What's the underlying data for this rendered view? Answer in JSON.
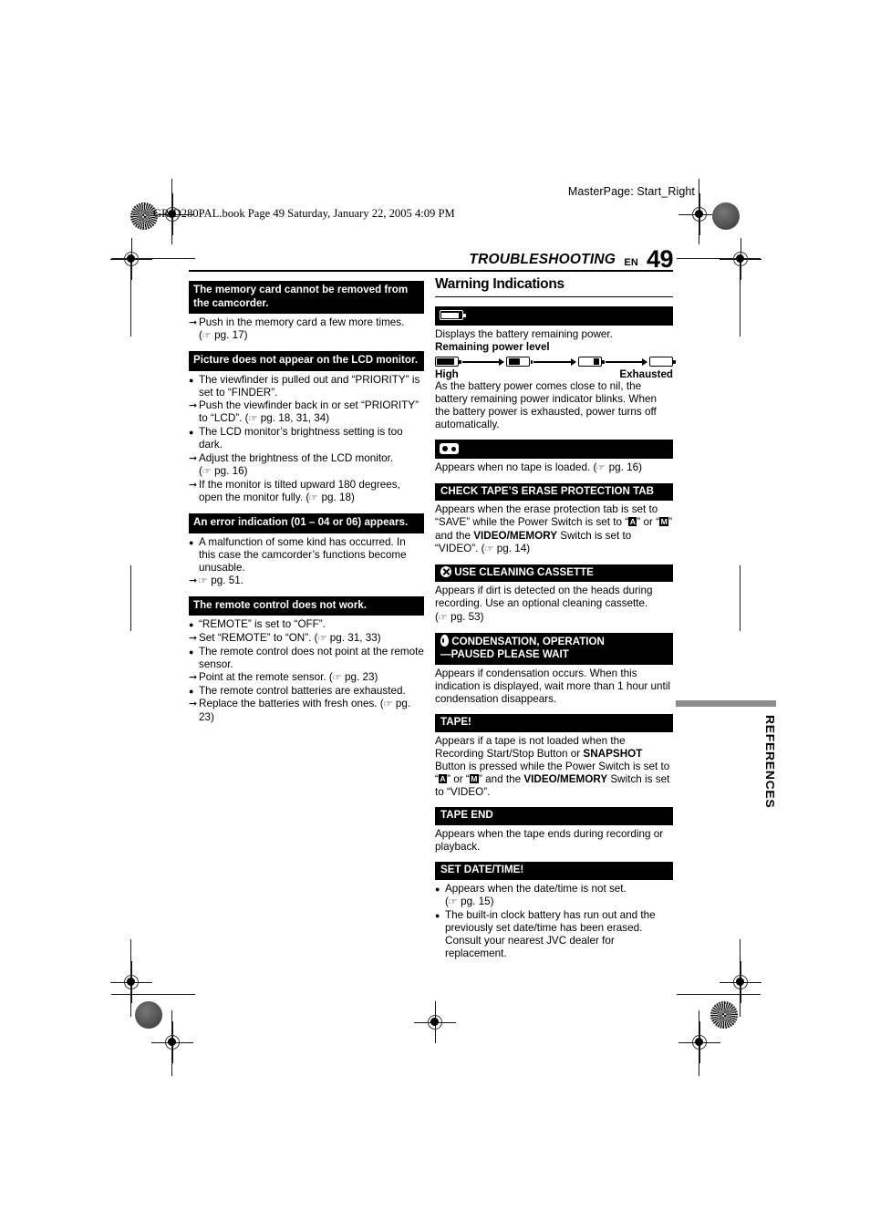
{
  "slugs": {
    "masterpage": "MasterPage: Start_Right",
    "book": "GR-D280PAL.book  Page 49  Saturday, January 22, 2005  4:09 PM"
  },
  "header": {
    "title": "TROUBLESHOOTING",
    "lang": "EN",
    "page_number": "49"
  },
  "side_tab": {
    "label": "REFERENCES",
    "bar_color": "#8c8c8c"
  },
  "left_column": {
    "sections": [
      {
        "heading": "The memory card cannot be removed from the camcorder.",
        "items": [
          {
            "marker": "arrow",
            "text": "Push in the memory card a few more times."
          },
          {
            "marker": "none-indent",
            "ref": "pg. 17",
            "text": ""
          }
        ]
      },
      {
        "heading": "Picture does not appear on the LCD monitor.",
        "items": [
          {
            "marker": "dot",
            "text": "The viewfinder is pulled out and “PRIORITY” is set to “FINDER”."
          },
          {
            "marker": "arrow",
            "text": "Push the viewfinder back in or set “PRIORITY” to “LCD”.",
            "ref": "pg. 18, 31, 34"
          },
          {
            "marker": "dot",
            "text": "The LCD monitor’s brightness setting is too dark."
          },
          {
            "marker": "arrow",
            "text": "Adjust the brightness of the LCD monitor."
          },
          {
            "marker": "none-indent",
            "ref": "pg. 16",
            "text": ""
          },
          {
            "marker": "arrow",
            "text": "If the monitor is tilted upward 180 degrees, open the monitor fully.",
            "ref": "pg. 18"
          }
        ]
      },
      {
        "heading": "An error indication (01 – 04 or 06) appears.",
        "items": [
          {
            "marker": "dot",
            "text": "A malfunction of some kind has occurred. In this case the camcorder’s functions become unusable."
          },
          {
            "marker": "arrow",
            "text": "",
            "ref": "pg. 51."
          }
        ]
      },
      {
        "heading": "The remote control does not work.",
        "items": [
          {
            "marker": "dot",
            "text": "“REMOTE” is set to “OFF”."
          },
          {
            "marker": "arrow",
            "text": "Set “REMOTE” to “ON”.",
            "ref": "pg. 31, 33"
          },
          {
            "marker": "dot",
            "text": "The remote control does not point at the remote sensor."
          },
          {
            "marker": "arrow",
            "text": "Point at the remote sensor.",
            "ref": "pg. 23"
          },
          {
            "marker": "dot",
            "text": "The remote control batteries are exhausted."
          },
          {
            "marker": "arrow",
            "text": "Replace the batteries with fresh ones.",
            "ref": "pg. 23"
          }
        ]
      }
    ]
  },
  "right_column": {
    "section_title": "Warning Indications",
    "battery": {
      "bar_icon": "battery-icon",
      "intro": "Displays the battery remaining power.",
      "level_label": "Remaining power level",
      "levels": [
        "battery-3-bars",
        "battery-2-bars",
        "battery-1-bar",
        "battery-empty"
      ],
      "end_high": "High",
      "end_exhausted": "Exhausted",
      "note": "As the battery power comes close to nil, the battery remaining power indicator blinks. When the battery power is exhausted, power turns off automatically."
    },
    "no_tape": {
      "bar_icon": "tape-icon",
      "text": "Appears when no tape is loaded. (",
      "ref": "pg. 16",
      "text_tail": ")"
    },
    "erase_tab": {
      "heading": "CHECK TAPE’S ERASE PROTECTION TAB",
      "text_1": "Appears when the erase protection tab is set to “SAVE” while the Power Switch is set to “",
      "sw_a": "A",
      "text_2": "” or “",
      "sw_m": "M",
      "text_3": "” and the ",
      "bold_vm": "VIDEO/MEMORY",
      "text_4": " Switch is set to “VIDEO”. (",
      "ref": "pg. 14",
      "text_5": ")"
    },
    "cleaning": {
      "icon": "circle-x-icon",
      "heading": "USE CLEANING CASSETTE",
      "text": "Appears if dirt is detected on the heads during recording. Use an optional cleaning cassette.",
      "ref": "pg. 53"
    },
    "condensation": {
      "icon": "droplet-icon",
      "heading_line1": "CONDENSATION, OPERATION",
      "heading_line2": "—PAUSED PLEASE WAIT",
      "text": "Appears if condensation occurs. When this indication is displayed, wait more than 1 hour until condensation disappears."
    },
    "tape_excl": {
      "heading": "TAPE!",
      "text_1": "Appears if a tape is not loaded when the Recording Start/Stop Button or ",
      "bold_snapshot": "SNAPSHOT",
      "text_2": " Button is pressed while the Power Switch is set to “",
      "sw_a": "A",
      "text_3": "” or “",
      "sw_m": "M",
      "text_4": "” and the ",
      "bold_vm": "VIDEO/MEMORY",
      "text_5": " Switch is set to “VIDEO”."
    },
    "tape_end": {
      "heading": "TAPE END",
      "text": "Appears when the tape ends during recording or playback."
    },
    "set_datetime": {
      "heading": "SET DATE/TIME!",
      "item_1": "Appears when the date/time is not set.",
      "item_1_ref": "pg. 15",
      "item_2": "The built-in clock battery has run out and the previously set date/time has been erased. Consult your nearest JVC dealer for replacement."
    }
  }
}
